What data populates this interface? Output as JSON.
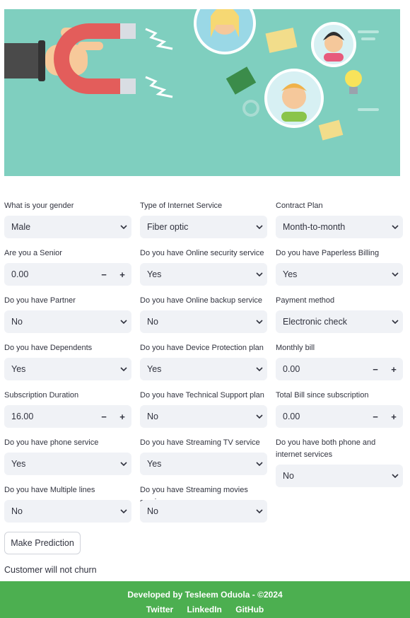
{
  "hero": {
    "image_name": "customer-magnet-illustration"
  },
  "form": {
    "columns": [
      [
        {
          "label": "What is your gender",
          "type": "select",
          "value": "Male"
        },
        {
          "label": "Are you a Senior",
          "type": "number",
          "value": "0.00"
        },
        {
          "label": "Do you have Partner",
          "type": "select",
          "value": "No"
        },
        {
          "label": "Do you have Dependents",
          "type": "select",
          "value": "Yes"
        },
        {
          "label": "Subscription Duration",
          "type": "number",
          "value": "16.00"
        },
        {
          "label": "Do you have phone service",
          "type": "select",
          "value": "Yes"
        },
        {
          "label": "Do you have Multiple lines",
          "type": "select",
          "value": "No"
        }
      ],
      [
        {
          "label": "Type of Internet Service",
          "type": "select",
          "value": "Fiber optic"
        },
        {
          "label": "Do you have Online security service",
          "type": "select",
          "value": "Yes"
        },
        {
          "label": "Do you have Online backup service",
          "type": "select",
          "value": "No"
        },
        {
          "label": "Do you have Device Protection plan",
          "type": "select",
          "value": "Yes"
        },
        {
          "label": "Do you have Technical Support plan",
          "type": "select",
          "value": "No"
        },
        {
          "label": "Do you have Streaming TV service",
          "type": "select",
          "value": "Yes"
        },
        {
          "label": "Do you have Streaming movies service",
          "type": "select",
          "value": "No"
        }
      ],
      [
        {
          "label": "Contract Plan",
          "type": "select",
          "value": "Month-to-month"
        },
        {
          "label": "Do you have Paperless Billing",
          "type": "select",
          "value": "Yes"
        },
        {
          "label": "Payment method",
          "type": "select",
          "value": "Electronic check"
        },
        {
          "label": "Monthly bill",
          "type": "number",
          "value": "0.00"
        },
        {
          "label": "Total Bill since subscription",
          "type": "number",
          "value": "0.00"
        },
        {
          "label": "Do you have both phone and internet services",
          "type": "select",
          "value": "No",
          "tall": true
        }
      ]
    ],
    "stepper": {
      "minus": "−",
      "plus": "+"
    }
  },
  "predict_button": "Make Prediction",
  "result_text": "Customer will not churn",
  "footer": {
    "credit": "Developed by Tesleem Oduola - ©2024",
    "links": [
      "Twitter",
      "LinkedIn",
      "GitHub"
    ],
    "bg_color": "#4caf50"
  }
}
